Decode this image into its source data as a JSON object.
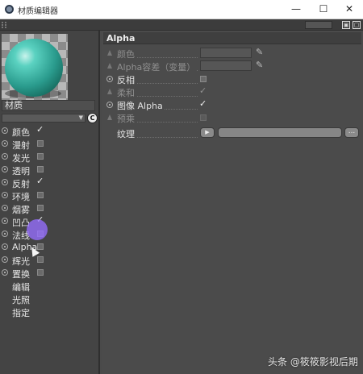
{
  "window": {
    "title": "材质编辑器",
    "minimize": "—",
    "maximize": "☐",
    "close": "✕"
  },
  "toolbar": {
    "back_arrow": "◀",
    "lock_icon": "🔒",
    "new_window_icon": "⧉"
  },
  "left_panel": {
    "material_name": "材质",
    "channels": [
      {
        "label": "颜色",
        "checked": true
      },
      {
        "label": "漫射",
        "checked": false
      },
      {
        "label": "发光",
        "checked": false
      },
      {
        "label": "透明",
        "checked": false
      },
      {
        "label": "反射",
        "checked": true
      },
      {
        "label": "环境",
        "checked": false
      },
      {
        "label": "烟雾",
        "checked": false
      },
      {
        "label": "凹凸",
        "checked": true
      },
      {
        "label": "法线",
        "checked": false
      },
      {
        "label": "Alpha",
        "checked": false
      },
      {
        "label": "辉光",
        "checked": false
      },
      {
        "label": "置换",
        "checked": false
      }
    ],
    "extra_items": [
      "编辑",
      "光照",
      "指定"
    ]
  },
  "right_panel": {
    "section_title": "Alpha",
    "props": {
      "color": "颜色",
      "alpha_tolerance": "Alpha容差（变量）",
      "invert": "反相",
      "soft": "柔和",
      "image_alpha": "图像 Alpha",
      "premultiplied": "预乘",
      "texture": "纹理"
    },
    "checks": {
      "invert": false,
      "soft": true,
      "image_alpha": true,
      "premultiplied": false
    },
    "texture_more": "...",
    "texture_play": "▶"
  },
  "watermark": "头条 @筱筱影视后期"
}
